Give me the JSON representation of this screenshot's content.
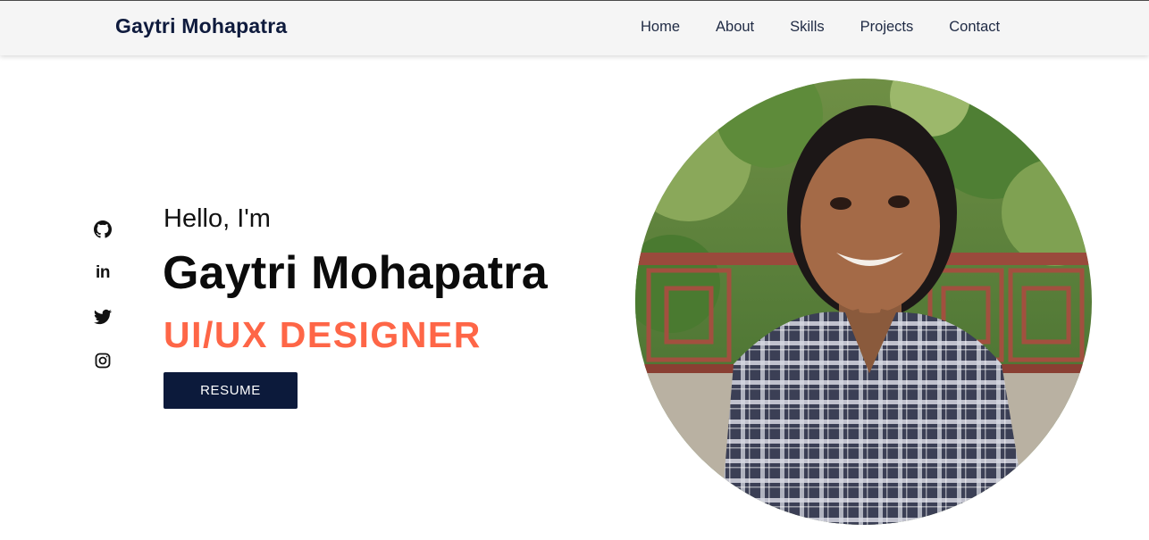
{
  "header": {
    "brand": "Gaytri Mohapatra",
    "nav": [
      {
        "label": "Home"
      },
      {
        "label": "About"
      },
      {
        "label": "Skills"
      },
      {
        "label": "Projects"
      },
      {
        "label": "Contact"
      }
    ]
  },
  "socials": [
    {
      "icon": "github-icon",
      "label": "GitHub"
    },
    {
      "icon": "linkedin-icon",
      "label": "LinkedIn",
      "glyph": "in"
    },
    {
      "icon": "twitter-icon",
      "label": "Twitter"
    },
    {
      "icon": "instagram-icon",
      "label": "Instagram"
    }
  ],
  "hero": {
    "greeting": "Hello, I'm",
    "name": "Gaytri Mohapatra",
    "role": "UI/UX DESIGNER",
    "resume_label": "RESUME"
  },
  "portrait": {
    "shape": "circle",
    "subject": "profile-photo"
  },
  "colors": {
    "accent": "#fe6647",
    "navy": "#0c1a3b",
    "header_bg": "#f5f5f5",
    "text": "#0b0b0b"
  }
}
